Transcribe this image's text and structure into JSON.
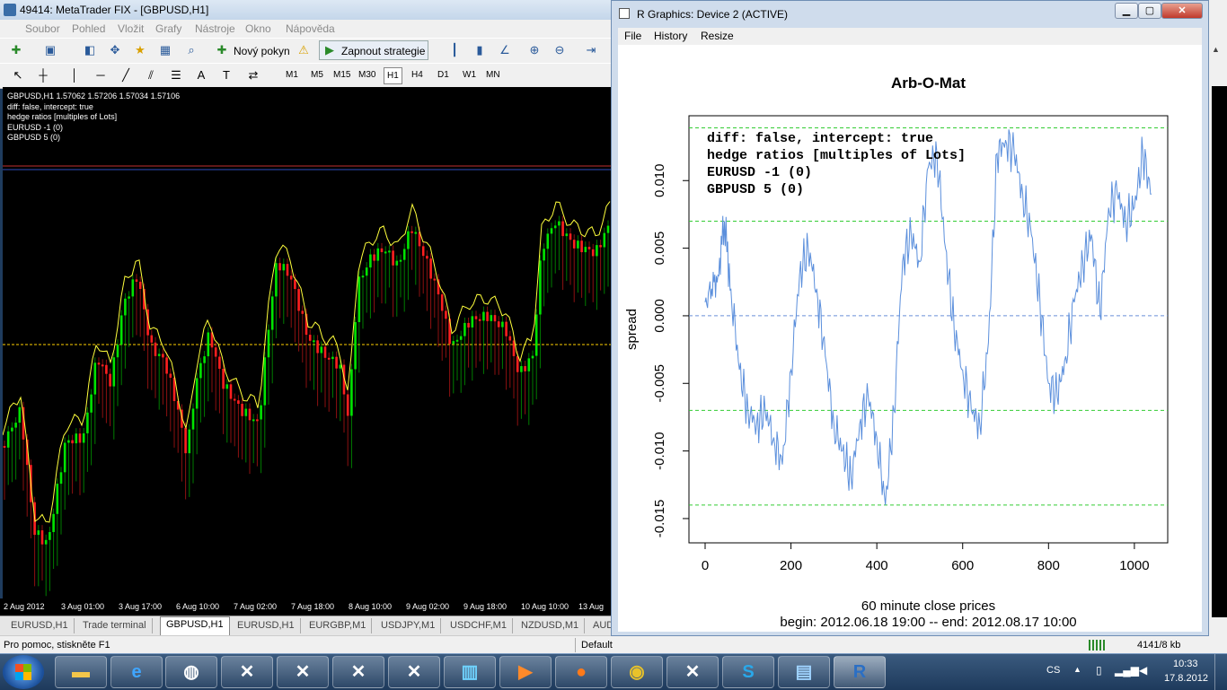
{
  "mt": {
    "title": "49414: MetaTrader FIX - [GBPUSD,H1]",
    "menu": [
      "Soubor",
      "Pohled",
      "Vložit",
      "Grafy",
      "Nástroje",
      "Okno",
      "Nápověda"
    ],
    "toolbar": {
      "new_order": "Nový pokyn",
      "auto_trading": "Zapnout strategie"
    },
    "timeframes": [
      "M1",
      "M5",
      "M15",
      "M30",
      "H1",
      "H4",
      "D1",
      "W1",
      "MN"
    ],
    "chart_info": [
      "GBPUSD,H1  1.57062 1.57206 1.57034 1.57106",
      "diff: false, intercept: true",
      "hedge ratios [multiples of Lots]",
      "EURUSD -1 (0)",
      "GBPUSD 5 (0)"
    ],
    "time_labels": [
      "2 Aug 2012",
      "3 Aug 01:00",
      "3 Aug 17:00",
      "6 Aug 10:00",
      "7 Aug 02:00",
      "7 Aug 18:00",
      "8 Aug 10:00",
      "9 Aug 02:00",
      "9 Aug 18:00",
      "10 Aug 10:00",
      "13 Aug"
    ],
    "tabs": [
      "EURUSD,H1",
      "Trade terminal",
      "GBPUSD,H1",
      "EURUSD,H1",
      "EURGBP,M1",
      "USDJPY,M1",
      "USDCHF,M1",
      "NZDUSD,M1",
      "AUD"
    ],
    "active_tab": "GBPUSD,H1",
    "status_help": "Pro pomoc, stiskněte F1",
    "status_profile": "Default",
    "status_traffic": "4141/8 kb",
    "colors": {
      "bull": "#00e400",
      "bear": "#ff1f1f",
      "close_line": "#ffff3c",
      "level": "#ffd000"
    }
  },
  "r": {
    "title": "R Graphics: Device 2 (ACTIVE)",
    "menu": [
      "File",
      "History",
      "Resize"
    ]
  },
  "chart_data": {
    "type": "line",
    "title": "Arb-O-Mat",
    "xlabel": "60 minute close prices",
    "subtitle": "begin: 2012.06.18 19:00 -- end: 2012.08.17 10:00",
    "ylabel": "spread",
    "xlim": [
      0,
      1040
    ],
    "ylim": [
      -0.016,
      0.014
    ],
    "x_ticks": [
      0,
      200,
      400,
      600,
      800,
      1000
    ],
    "y_ticks": [
      -0.015,
      -0.01,
      -0.005,
      0.0,
      0.005,
      0.01
    ],
    "y_tick_labels": [
      "-0.015",
      "-0.010",
      "-0.005",
      "0.000",
      "0.005",
      "0.010"
    ],
    "annotations": [
      "diff: false, intercept: true",
      "hedge ratios [multiples of Lots]",
      "EURUSD -1 (0)",
      "GBPUSD 5 (0)"
    ],
    "hlines": [
      {
        "y": 0.0139,
        "style": "dashed",
        "color": "#33cc33"
      },
      {
        "y": 0.007,
        "style": "dashed",
        "color": "#33cc33"
      },
      {
        "y": 0.0,
        "style": "dashed",
        "color": "#6a8fd8"
      },
      {
        "y": -0.007,
        "style": "dashed",
        "color": "#33cc33"
      },
      {
        "y": -0.014,
        "style": "dashed",
        "color": "#33cc33"
      }
    ],
    "series": [
      {
        "color": "#5b8fdc",
        "x": [
          0,
          15,
          30,
          45,
          60,
          80,
          100,
          120,
          140,
          160,
          180,
          200,
          220,
          240,
          260,
          280,
          300,
          320,
          340,
          360,
          380,
          400,
          420,
          440,
          460,
          480,
          500,
          520,
          540,
          560,
          580,
          600,
          620,
          640,
          660,
          680,
          700,
          720,
          740,
          760,
          780,
          800,
          820,
          840,
          860,
          880,
          900,
          920,
          940,
          960,
          980,
          1000,
          1020,
          1040
        ],
        "y": [
          0.001,
          0.002,
          0.003,
          0.007,
          0.002,
          -0.004,
          -0.007,
          -0.008,
          -0.007,
          -0.009,
          -0.011,
          -0.004,
          0.003,
          0.005,
          0.002,
          -0.003,
          -0.008,
          -0.01,
          -0.012,
          -0.008,
          -0.006,
          -0.009,
          -0.014,
          -0.007,
          0.004,
          0.006,
          0.004,
          0.011,
          0.012,
          0.005,
          -0.001,
          -0.004,
          -0.007,
          -0.008,
          -0.002,
          0.012,
          0.013,
          0.012,
          0.009,
          0.006,
          0.001,
          -0.005,
          -0.006,
          -0.003,
          0.001,
          0.004,
          0.006,
          0.0,
          0.008,
          0.009,
          0.007,
          0.008,
          0.012,
          0.009
        ]
      }
    ]
  }
}
